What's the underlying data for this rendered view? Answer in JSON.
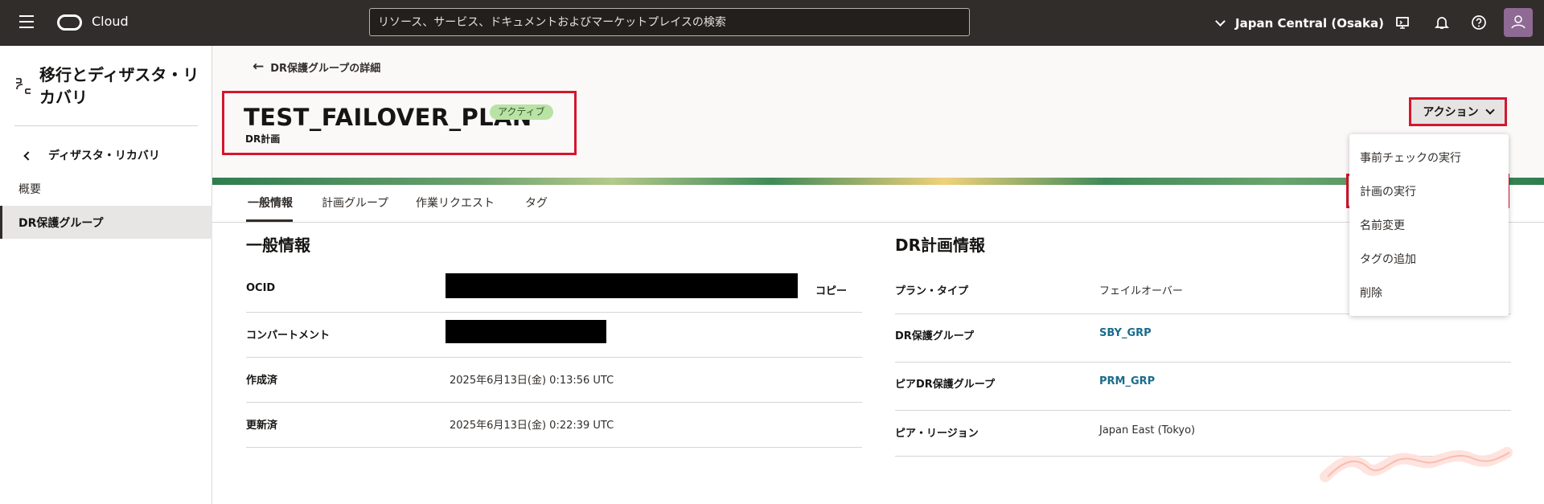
{
  "topbar": {
    "app_name": "Cloud",
    "search_placeholder": "リソース、サービス、ドキュメントおよびマーケットプレイスの検索",
    "region": "Japan Central (Osaka)"
  },
  "sidebar": {
    "title": "移行とディザスタ・リカバリ",
    "back_label": "ディザスタ・リカバリ",
    "items": [
      {
        "label": "概要"
      },
      {
        "label": "DR保護グループ"
      }
    ]
  },
  "page": {
    "breadcrumb": "DR保護グループの詳細",
    "title": "TEST_FAILOVER_PLAN",
    "status": "アクティブ",
    "subtitle": "DR計画",
    "actions_label": "アクション"
  },
  "tabs": [
    {
      "label": "一般情報"
    },
    {
      "label": "計画グループ"
    },
    {
      "label": "作業リクエスト"
    },
    {
      "label": "タグ"
    }
  ],
  "general_info": {
    "title": "一般情報",
    "ocid_label": "OCID",
    "copy_label": "コピー",
    "compartment_label": "コンパートメント",
    "created_label": "作成済",
    "created_value": "2025年6月13日(金) 0:13:56 UTC",
    "updated_label": "更新済",
    "updated_value": "2025年6月13日(金) 0:22:39 UTC"
  },
  "dr_plan_info": {
    "title": "DR計画情報",
    "plan_type_label": "プラン・タイプ",
    "plan_type_value": "フェイルオーバー",
    "dr_group_label": "DR保護グループ",
    "dr_group_value": "SBY_GRP",
    "peer_group_label": "ピアDR保護グループ",
    "peer_group_value": "PRM_GRP",
    "peer_region_label": "ピア・リージョン",
    "peer_region_value": "Japan East (Tokyo)"
  },
  "actions_menu": {
    "items": [
      {
        "label": "事前チェックの実行"
      },
      {
        "label": "計画の実行"
      },
      {
        "label": "名前変更"
      },
      {
        "label": "タグの追加"
      },
      {
        "label": "削除"
      }
    ]
  },
  "colors": {
    "topbar": "#312d2a",
    "highlight": "#d5162d",
    "link": "#1a6c8c",
    "badge": "#b9e2a5"
  }
}
